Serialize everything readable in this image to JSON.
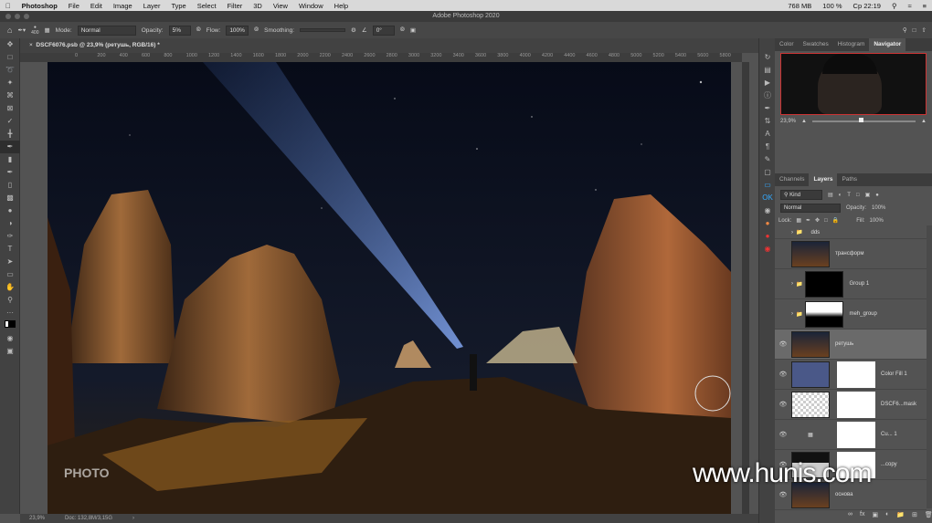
{
  "menubar": {
    "app": "Photoshop",
    "items": [
      "File",
      "Edit",
      "Image",
      "Layer",
      "Type",
      "Select",
      "Filter",
      "3D",
      "View",
      "Window",
      "Help"
    ],
    "memory": "768 MB",
    "battery": "100 %",
    "clock": "Ср 22:19"
  },
  "title": "Adobe Photoshop 2020",
  "options": {
    "brush_size": "400",
    "mode_label": "Mode:",
    "mode": "Normal",
    "opacity_label": "Opacity:",
    "opacity": "5%",
    "flow_label": "Flow:",
    "flow": "100%",
    "smoothing_label": "Smoothing:",
    "angle": "0°"
  },
  "document": {
    "tab": "DSCF6076.psb @ 23,9% (ретушь, RGB/16) *",
    "ruler": [
      "0",
      "200",
      "400",
      "600",
      "800",
      "1000",
      "1200",
      "1400",
      "1600",
      "1800",
      "2000",
      "2200",
      "2400",
      "2600",
      "2800",
      "3000",
      "3200",
      "3400",
      "3600",
      "3800",
      "4000",
      "4200",
      "4400",
      "4600",
      "4800",
      "5000",
      "5200",
      "5400",
      "5600",
      "5800"
    ],
    "zoom": "23,9%",
    "doc_size": "Doc: 132,8M/3,15G"
  },
  "panels": {
    "top_tabs": [
      "Color",
      "Swatches",
      "Histogram",
      "Navigator"
    ],
    "nav_zoom": "23,9%",
    "layer_tabs": [
      "Channels",
      "Layers",
      "Paths"
    ],
    "kind": "Kind",
    "blend": "Normal",
    "opacity_label": "Opacity:",
    "opacity": "100%",
    "lock_label": "Lock:",
    "fill_label": "Fill:",
    "fill": "100%",
    "layers": [
      {
        "name": "dds",
        "type": "group"
      },
      {
        "name": "трансформ"
      },
      {
        "name": "Group 1",
        "type": "group"
      },
      {
        "name": "meh_group",
        "type": "group"
      },
      {
        "name": "ретушь",
        "selected": true
      },
      {
        "name": "Color Fill 1"
      },
      {
        "name": "DSCF6...mask"
      },
      {
        "name": "Cu... 1"
      },
      {
        "name": "...copy"
      },
      {
        "name": "основа"
      }
    ]
  },
  "watermark": "www.hunis.com",
  "logo": "PHOTO"
}
